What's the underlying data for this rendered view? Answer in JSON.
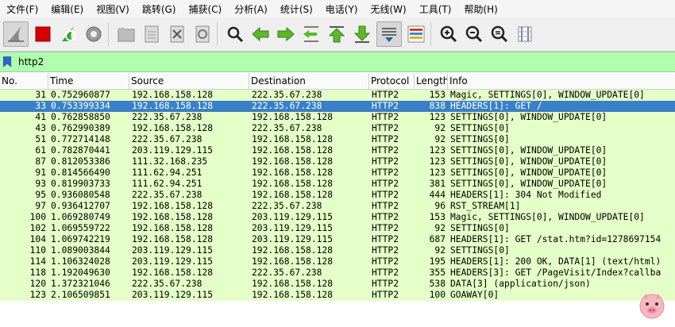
{
  "menu": [
    "文件(F)",
    "编辑(E)",
    "视图(V)",
    "跳转(G)",
    "捕获(C)",
    "分析(A)",
    "统计(S)",
    "电话(Y)",
    "无线(W)",
    "工具(T)",
    "帮助(H)"
  ],
  "toolbar": {
    "icons": [
      "shark-fin-icon",
      "stop-capture-icon",
      "restart-capture-icon",
      "capture-options-icon",
      "open-file-icon",
      "save-file-icon",
      "close-file-icon",
      "reload-file-icon",
      "find-packet-icon",
      "go-back-icon",
      "go-forward-icon",
      "go-to-packet-icon",
      "go-first-packet-icon",
      "go-last-packet-icon",
      "autoscroll-icon",
      "colorize-icon",
      "zoom-in-icon",
      "zoom-out-icon",
      "normal-size-icon",
      "resize-columns-icon"
    ]
  },
  "filter": {
    "value": "http2",
    "color": "#afffaf"
  },
  "columns": [
    "No.",
    "Time",
    "Source",
    "Destination",
    "Protocol",
    "Length",
    "Info"
  ],
  "packets": [
    {
      "no": "31",
      "time": "0.752960877",
      "src": "192.168.158.128",
      "dst": "222.35.67.238",
      "proto": "HTTP2",
      "len": "153",
      "info": "Magic, SETTINGS[0], WINDOW_UPDATE[0]",
      "selected": false
    },
    {
      "no": "33",
      "time": "0.753399334",
      "src": "192.168.158.128",
      "dst": "222.35.67.238",
      "proto": "HTTP2",
      "len": "838",
      "info": "HEADERS[1]: GET /",
      "selected": true
    },
    {
      "no": "41",
      "time": "0.762858850",
      "src": "222.35.67.238",
      "dst": "192.168.158.128",
      "proto": "HTTP2",
      "len": "123",
      "info": "SETTINGS[0], WINDOW_UPDATE[0]",
      "selected": false
    },
    {
      "no": "43",
      "time": "0.762990389",
      "src": "192.168.158.128",
      "dst": "222.35.67.238",
      "proto": "HTTP2",
      "len": "92",
      "info": "SETTINGS[0]",
      "selected": false
    },
    {
      "no": "51",
      "time": "0.772714148",
      "src": "222.35.67.238",
      "dst": "192.168.158.128",
      "proto": "HTTP2",
      "len": "92",
      "info": "SETTINGS[0]",
      "selected": false
    },
    {
      "no": "61",
      "time": "0.782870441",
      "src": "203.119.129.115",
      "dst": "192.168.158.128",
      "proto": "HTTP2",
      "len": "123",
      "info": "SETTINGS[0], WINDOW_UPDATE[0]",
      "selected": false
    },
    {
      "no": "87",
      "time": "0.812053386",
      "src": "111.32.168.235",
      "dst": "192.168.158.128",
      "proto": "HTTP2",
      "len": "123",
      "info": "SETTINGS[0], WINDOW_UPDATE[0]",
      "selected": false
    },
    {
      "no": "91",
      "time": "0.814566490",
      "src": "111.62.94.251",
      "dst": "192.168.158.128",
      "proto": "HTTP2",
      "len": "123",
      "info": "SETTINGS[0], WINDOW_UPDATE[0]",
      "selected": false
    },
    {
      "no": "93",
      "time": "0.819903733",
      "src": "111.62.94.251",
      "dst": "192.168.158.128",
      "proto": "HTTP2",
      "len": "381",
      "info": "SETTINGS[0], WINDOW_UPDATE[0]",
      "selected": false
    },
    {
      "no": "95",
      "time": "0.936080548",
      "src": "222.35.67.238",
      "dst": "192.168.158.128",
      "proto": "HTTP2",
      "len": "444",
      "info": "HEADERS[1]: 304 Not Modified",
      "selected": false
    },
    {
      "no": "97",
      "time": "0.936412707",
      "src": "192.168.158.128",
      "dst": "222.35.67.238",
      "proto": "HTTP2",
      "len": "96",
      "info": "RST_STREAM[1]",
      "selected": false
    },
    {
      "no": "100",
      "time": "1.069280749",
      "src": "192.168.158.128",
      "dst": "203.119.129.115",
      "proto": "HTTP2",
      "len": "153",
      "info": "Magic, SETTINGS[0], WINDOW_UPDATE[0]",
      "selected": false
    },
    {
      "no": "102",
      "time": "1.069559722",
      "src": "192.168.158.128",
      "dst": "203.119.129.115",
      "proto": "HTTP2",
      "len": "92",
      "info": "SETTINGS[0]",
      "selected": false
    },
    {
      "no": "104",
      "time": "1.069742219",
      "src": "192.168.158.128",
      "dst": "203.119.129.115",
      "proto": "HTTP2",
      "len": "687",
      "info": "HEADERS[1]: GET /stat.htm?id=1278697154",
      "selected": false
    },
    {
      "no": "110",
      "time": "1.089003844",
      "src": "203.119.129.115",
      "dst": "192.168.158.128",
      "proto": "HTTP2",
      "len": "92",
      "info": "SETTINGS[0]",
      "selected": false
    },
    {
      "no": "114",
      "time": "1.106324028",
      "src": "203.119.129.115",
      "dst": "192.168.158.128",
      "proto": "HTTP2",
      "len": "195",
      "info": "HEADERS[1]: 200 OK, DATA[1] (text/html)",
      "selected": false
    },
    {
      "no": "118",
      "time": "1.192049630",
      "src": "192.168.158.128",
      "dst": "222.35.67.238",
      "proto": "HTTP2",
      "len": "355",
      "info": "HEADERS[3]: GET /PageVisit/Index?callba",
      "selected": false
    },
    {
      "no": "120",
      "time": "1.372321046",
      "src": "222.35.67.238",
      "dst": "192.168.158.128",
      "proto": "HTTP2",
      "len": "538",
      "info": "DATA[3] (application/json)",
      "selected": false
    },
    {
      "no": "123",
      "time": "2.106509851",
      "src": "203.119.129.115",
      "dst": "192.168.158.128",
      "proto": "HTTP2",
      "len": "100",
      "info": "GOAWAY[0]",
      "selected": false
    }
  ],
  "colors": {
    "row_bg": "#e4ffc7",
    "selected_bg": "#3a80c6",
    "filter_bg": "#afffaf"
  },
  "mascot": "pig-mascot-icon"
}
